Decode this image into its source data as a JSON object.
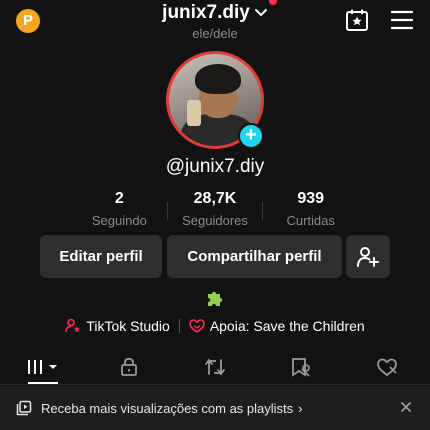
{
  "header": {
    "coin_label": "P",
    "username": "junix7.diy",
    "pronouns": "ele/dele"
  },
  "profile": {
    "handle": "@junix7.diy",
    "avatar_add_label": "+"
  },
  "stats": [
    {
      "value": "2",
      "label": "Seguindo"
    },
    {
      "value": "28,7K",
      "label": "Seguidores"
    },
    {
      "value": "939",
      "label": "Curtidas"
    }
  ],
  "actions": {
    "edit_label": "Editar perfil",
    "share_label": "Compartilhar perfil"
  },
  "links": {
    "studio_label": "TikTok Studio",
    "charity_label": "Apoia: Save the Children"
  },
  "tabs": [
    {
      "icon": "grid-icon",
      "active": true
    },
    {
      "icon": "lock-icon",
      "active": false
    },
    {
      "icon": "repost-icon",
      "active": false
    },
    {
      "icon": "bookmark-tag-icon",
      "active": false
    },
    {
      "icon": "liked-heart-icon",
      "active": false
    }
  ],
  "banner": {
    "text": "Receba mais visualizações com as playlists",
    "arrow": "›"
  },
  "colors": {
    "background": "#121212",
    "accent_red": "#fe2c55",
    "add_badge": "#20d5ec",
    "coin": "#f5a623",
    "button_bg": "#2f2f2f"
  }
}
